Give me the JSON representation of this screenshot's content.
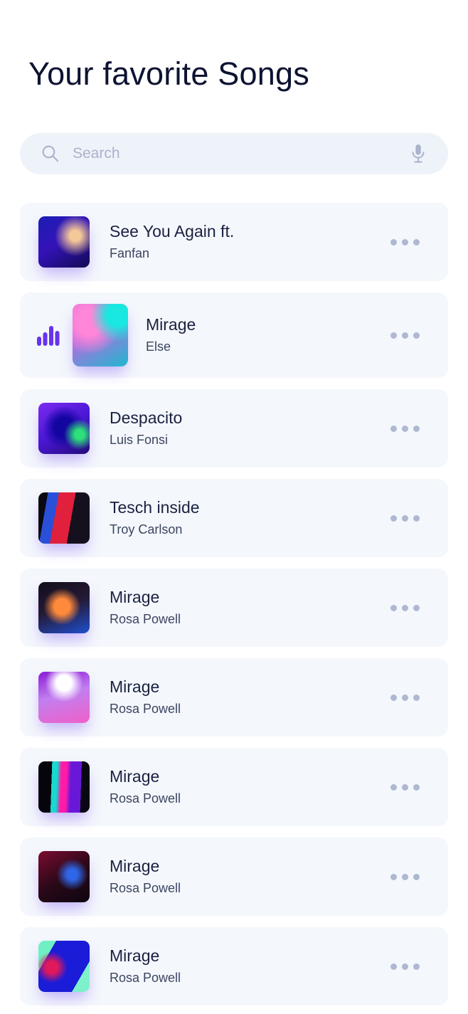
{
  "header": {
    "title": "Your favorite Songs"
  },
  "search": {
    "placeholder": "Search",
    "value": "",
    "search_icon": "search-icon",
    "mic_icon": "microphone-icon"
  },
  "colors": {
    "page_background": "#ffffff",
    "card_background": "#f4f7fc",
    "search_background": "#eef2f9",
    "title_text": "#0d1331",
    "song_title_text": "#1a2140",
    "song_artist_text": "#3c4560",
    "placeholder_text": "#a9b3cb",
    "more_dots": "#aeb8d0",
    "equalizer_accent": "#6633ee",
    "thumb_glow": "#7d50f5"
  },
  "list": {
    "more_menu_icon": "more-horizontal-icon",
    "now_playing_icon": "equalizer-icon",
    "songs": [
      {
        "title": "See You Again ft.",
        "artist": "Fanfan",
        "now_playing": false,
        "cover": "portrait-blue-neon"
      },
      {
        "title": "Mirage",
        "artist": "Else",
        "now_playing": true,
        "cover": "portrait-pink-cyan"
      },
      {
        "title": "Despacito",
        "artist": "Luis Fonsi",
        "now_playing": false,
        "cover": "portrait-purple-face-paint"
      },
      {
        "title": "Tesch inside",
        "artist": "Troy Carlson",
        "now_playing": false,
        "cover": "portrait-red-blue-split"
      },
      {
        "title": "Mirage",
        "artist": "Rosa Powell",
        "now_playing": false,
        "cover": "portrait-orange-dark"
      },
      {
        "title": "Mirage",
        "artist": "Rosa Powell",
        "now_playing": false,
        "cover": "portrait-lilac-crown"
      },
      {
        "title": "Mirage",
        "artist": "Rosa Powell",
        "now_playing": false,
        "cover": "portrait-teal-magenta-stripe"
      },
      {
        "title": "Mirage",
        "artist": "Rosa Powell",
        "now_playing": false,
        "cover": "portrait-crimson-profile"
      },
      {
        "title": "Mirage",
        "artist": "Rosa Powell",
        "now_playing": false,
        "cover": "portrait-mint-blue"
      }
    ]
  }
}
